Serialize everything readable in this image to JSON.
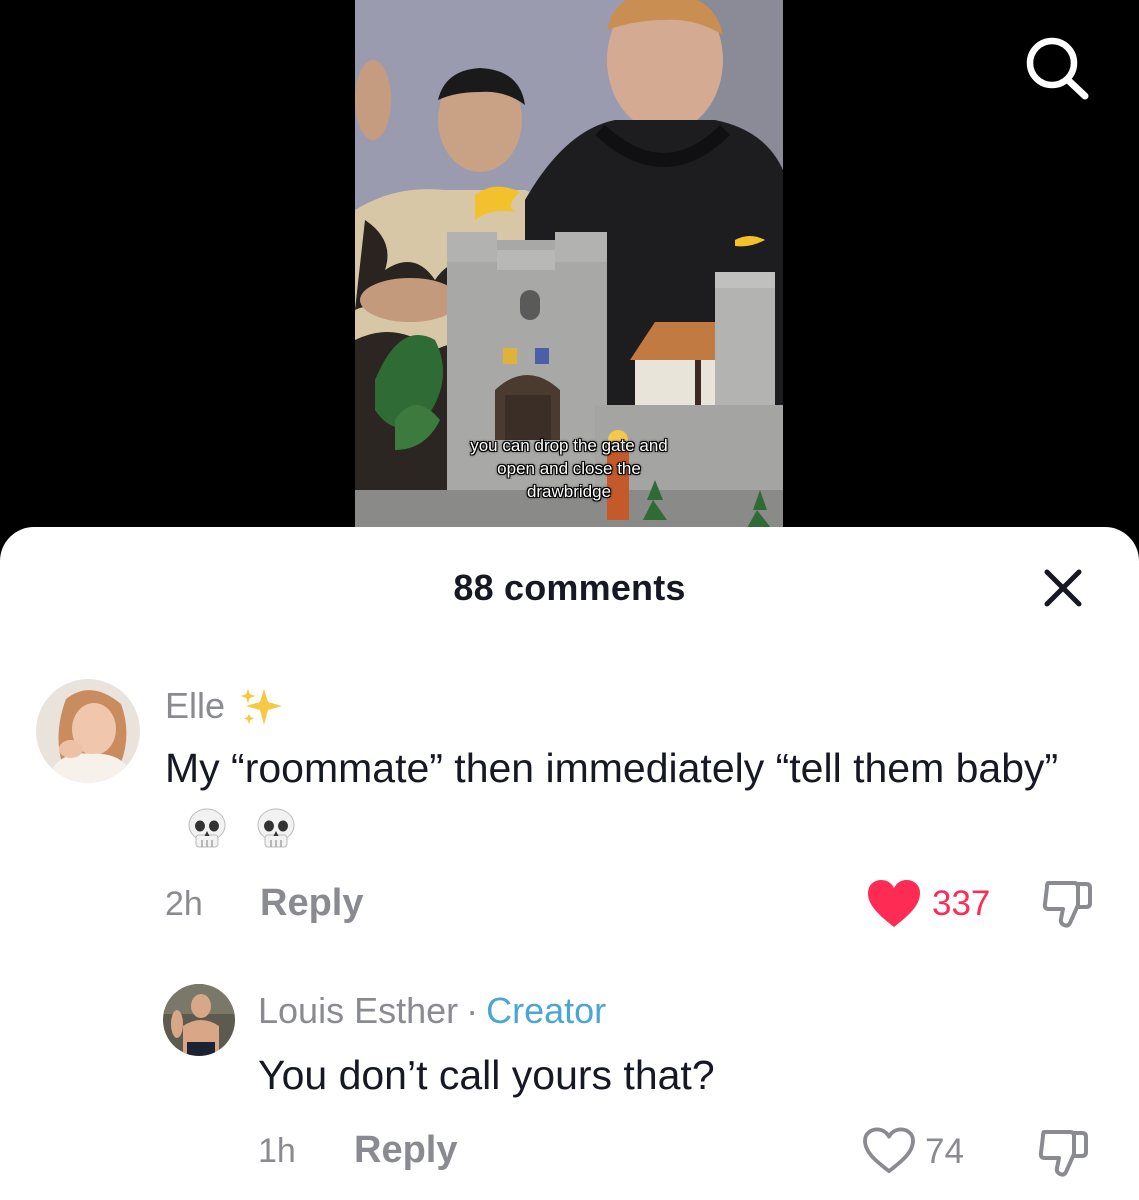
{
  "video": {
    "caption_lines": [
      "you can drop the gate and",
      "open and close the",
      "drawbridge"
    ]
  },
  "comments_sheet": {
    "title": "88 comments",
    "comments": [
      {
        "username": "Elle",
        "username_emoji": "sparkles-icon",
        "text": "My “roommate” then immediately “tell them baby”",
        "text_emoji": [
          "skull-icon",
          "skull-icon"
        ],
        "time": "2h",
        "reply_label": "Reply",
        "likes": "337",
        "liked": true
      },
      {
        "username": "Louis Esther",
        "separator": "·",
        "badge": "Creator",
        "text": "You don’t call yours that?",
        "time": "1h",
        "reply_label": "Reply",
        "likes": "74",
        "liked": false
      }
    ]
  },
  "colors": {
    "like_active": "#fe2c55",
    "creator_badge": "#4ba6d3",
    "secondary_text": "#8a8b91",
    "primary_text": "#161823"
  }
}
